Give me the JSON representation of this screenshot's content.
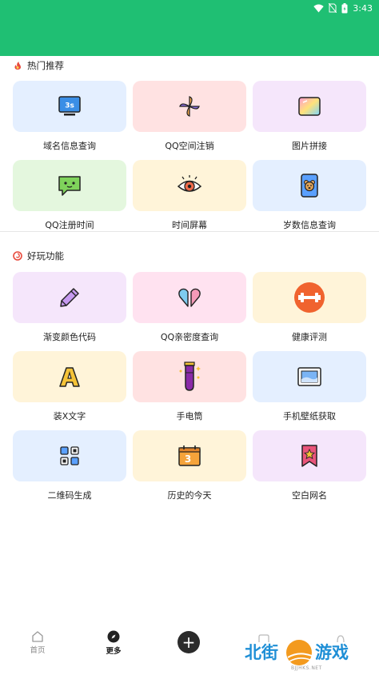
{
  "status_bar": {
    "time": "3:43",
    "background": "#1fbf73"
  },
  "sections": {
    "hot": {
      "title": "热门推荐",
      "icon": "flame-icon"
    },
    "fun": {
      "title": "好玩功能",
      "icon": "swirl-icon"
    }
  },
  "hot_tools": [
    {
      "label": "域名信息查询",
      "icon": "monitor-icon",
      "bg": "#e4efff"
    },
    {
      "label": "QQ空间注销",
      "icon": "pinwheel-icon",
      "bg": "#ffe2e2"
    },
    {
      "label": "图片拼接",
      "icon": "gradient-image-icon",
      "bg": "#f5e6fb"
    },
    {
      "label": "QQ注册时间",
      "icon": "chat-bubble-icon",
      "bg": "#e4f7de"
    },
    {
      "label": "时间屏幕",
      "icon": "eye-icon",
      "bg": "#fff4d9"
    },
    {
      "label": "岁数信息查询",
      "icon": "bear-photo-icon",
      "bg": "#e4efff"
    }
  ],
  "fun_tools": [
    {
      "label": "渐变颜色代码",
      "icon": "pencil-icon",
      "bg": "#f5e6fb"
    },
    {
      "label": "QQ亲密度查询",
      "icon": "split-heart-icon",
      "bg": "#ffe2f0"
    },
    {
      "label": "健康评测",
      "icon": "dumbbell-icon",
      "bg": "#fff4d9"
    },
    {
      "label": "装X文字",
      "icon": "letter-a-icon",
      "bg": "#fff4d9"
    },
    {
      "label": "手电筒",
      "icon": "potion-tube-icon",
      "bg": "#ffe2e2"
    },
    {
      "label": "手机壁纸获取",
      "icon": "picture-frame-icon",
      "bg": "#e4efff"
    },
    {
      "label": "二维码生成",
      "icon": "qr-code-icon",
      "bg": "#e4efff"
    },
    {
      "label": "历史的今天",
      "icon": "calendar-icon",
      "bg": "#fff4d9"
    },
    {
      "label": "空白网名",
      "icon": "star-badge-icon",
      "bg": "#f5e6fb"
    }
  ],
  "bottom_nav": {
    "home": "首页",
    "more": "更多",
    "add": "+"
  },
  "watermark": {
    "text_left": "北街",
    "text_right": "游戏",
    "sub": "BJJHKS.NET"
  }
}
